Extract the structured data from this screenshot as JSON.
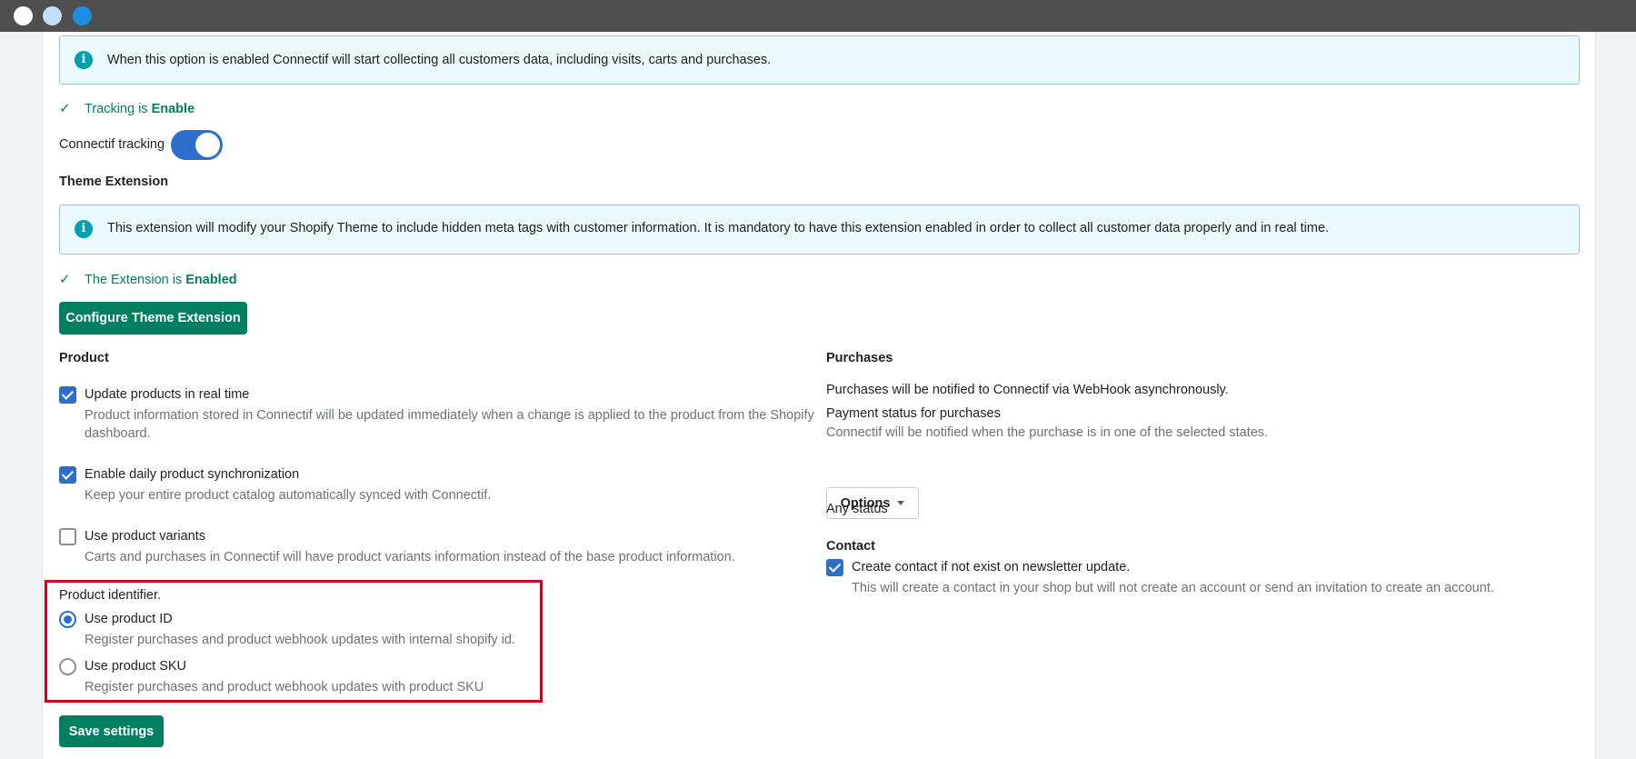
{
  "tracking": {
    "banner_text": "When this option is enabled Connectif will start collecting all customers data, including visits, carts and purchases.",
    "status_prefix": "Tracking is",
    "status_value": "Enable",
    "toggle_label": "Connectif tracking",
    "toggle_on": true
  },
  "theme_extension": {
    "heading": "Theme Extension",
    "banner_text": "This extension will modify your Shopify Theme to include hidden meta tags with customer information. It is mandatory to have this extension enabled in order to collect all customer data properly and in real time.",
    "status_prefix": "The Extension is",
    "status_value": "Enabled",
    "configure_button": "Configure Theme Extension"
  },
  "product": {
    "heading": "Product",
    "options": [
      {
        "label": "Update products in real time",
        "help": "Product information stored in Connectif will be updated immediately when a change is applied to the product from the Shopify dashboard.",
        "checked": true
      },
      {
        "label": "Enable daily product synchronization",
        "help": "Keep your entire product catalog automatically synced with Connectif.",
        "checked": true
      },
      {
        "label": "Use product variants",
        "help": "Carts and purchases in Connectif will have product variants information instead of the base product information.",
        "checked": false
      }
    ],
    "identifier": {
      "heading": "Product identifier.",
      "choices": [
        {
          "label": "Use product ID",
          "help": "Register purchases and product webhook updates with internal shopify id.",
          "selected": true
        },
        {
          "label": "Use product SKU",
          "help": "Register purchases and product webhook updates with product SKU",
          "selected": false
        }
      ]
    }
  },
  "purchases": {
    "heading": "Purchases",
    "description": "Purchases will be notified to Connectif via WebHook asynchronously.",
    "payment_label": "Payment status for purchases",
    "payment_help": "Connectif will be notified when the purchase is in one of the selected states.",
    "options_button": "Options",
    "selected_status": "Any status"
  },
  "contact": {
    "heading": "Contact",
    "option_label": "Create contact if not exist on newsletter update.",
    "option_help": "This will create a contact in your shop but will not create an account or send an invitation to create an account.",
    "checked": true
  },
  "save_button": "Save settings",
  "colors": {
    "accent": "#2c6ecb",
    "primary_button": "#008060",
    "success_text": "#007f5f",
    "highlight_box": "#d0021b"
  }
}
